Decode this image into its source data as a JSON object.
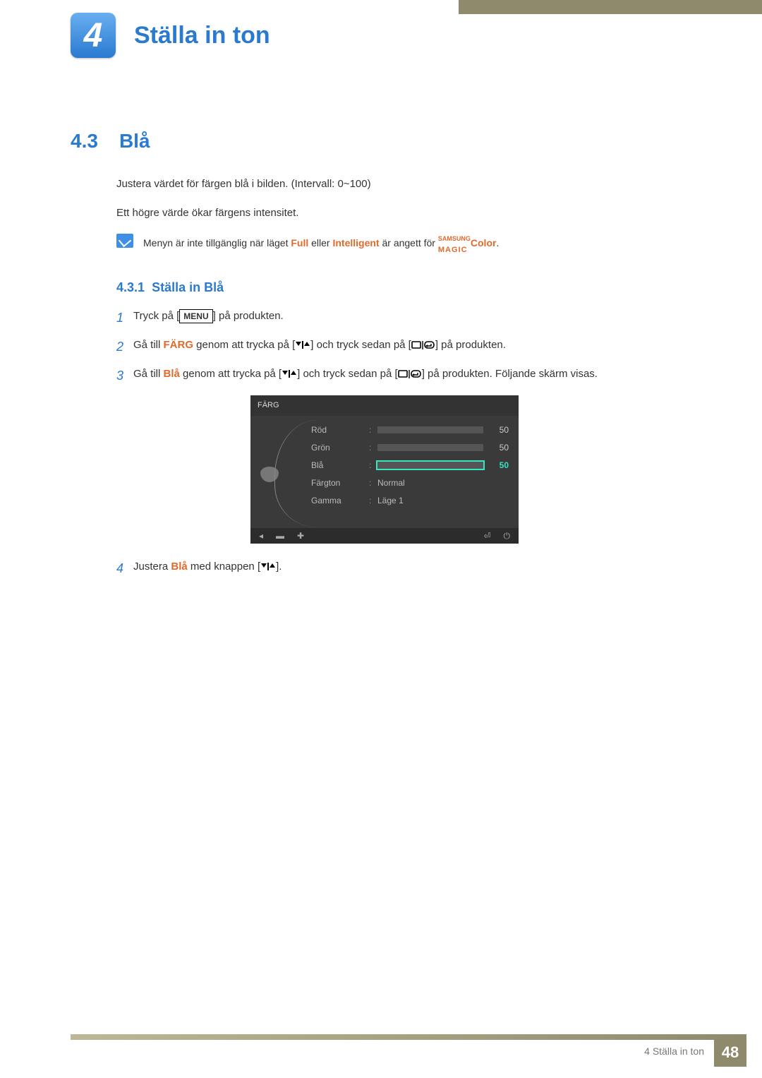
{
  "chapter": {
    "number": "4",
    "title": "Ställa in ton"
  },
  "section": {
    "number": "4.3",
    "title": "Blå"
  },
  "intro": {
    "p1": "Justera värdet för färgen blå i bilden. (Intervall: 0~100)",
    "p2": "Ett högre värde ökar färgens intensitet."
  },
  "note": {
    "pre": "Menyn är inte tillgänglig när läget ",
    "kw1": "Full",
    "mid": " eller ",
    "kw2": "Intelligent",
    "post1": " är angett för ",
    "magic_brand": "SAMSUNG",
    "magic": "MAGIC",
    "magic_suffix": "Color",
    "end": "."
  },
  "subsection": {
    "number": "4.3.1",
    "title": "Ställa in Blå"
  },
  "steps": {
    "s1": {
      "pre": "Tryck på [",
      "menu": "MENU",
      "post": "] på produkten."
    },
    "s2": {
      "pre": "Gå till ",
      "kw": "FÄRG",
      "mid": " genom att trycka på [",
      "mid2": "] och tryck sedan på [",
      "post": "] på produkten."
    },
    "s3": {
      "pre": "Gå till ",
      "kw": "Blå",
      "mid": " genom att trycka på [",
      "mid2": "] och tryck sedan på [",
      "post": "] på produkten. Följande skärm visas."
    },
    "s4": {
      "pre": "Justera ",
      "kw": "Blå",
      "mid": " med knappen [",
      "post": "]."
    }
  },
  "osd": {
    "title": "FÄRG",
    "rows": [
      {
        "label": "Röd",
        "value": "50",
        "percent": 50,
        "selected": false,
        "type": "bar"
      },
      {
        "label": "Grön",
        "value": "50",
        "percent": 50,
        "selected": false,
        "type": "bar"
      },
      {
        "label": "Blå",
        "value": "50",
        "percent": 50,
        "selected": true,
        "type": "bar"
      },
      {
        "label": "Färgton",
        "value": "Normal",
        "type": "text"
      },
      {
        "label": "Gamma",
        "value": "Läge 1",
        "type": "text"
      }
    ]
  },
  "footer": {
    "chapter": "4 Ställa in ton",
    "page": "48"
  }
}
